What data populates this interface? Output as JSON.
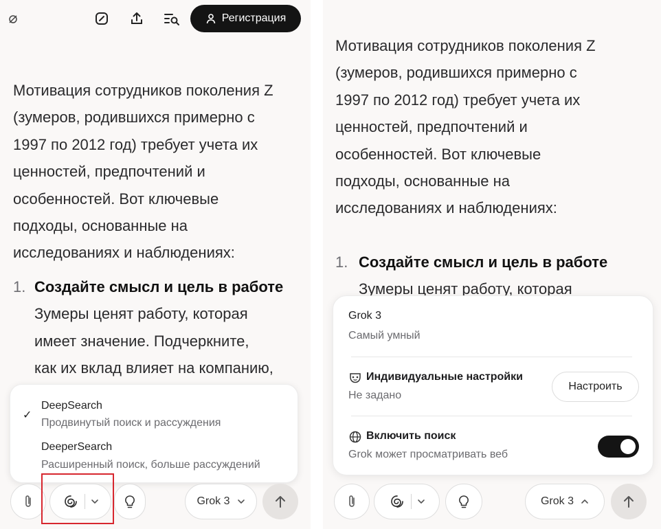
{
  "topbar": {
    "left_icon": "private-chat-icon",
    "edit_icon": "edit-icon",
    "share_icon": "share-icon",
    "history_icon": "history-search-icon",
    "register_label": "Регистрация",
    "register_icon": "user-icon"
  },
  "content": {
    "left_para": [
      "Мотивация сотрудников поколения Z",
      "(зумеров, родившихся примерно с",
      "1997 по 2012 год) требует учета их",
      "ценностей, предпочтений и",
      "особенностей. Вот ключевые",
      "подходы, основанные на",
      "исследованиях и наблюдениях:"
    ],
    "right_para": [
      "Мотивация сотрудников поколения Z",
      "(зумеров, родившихся примерно с",
      "1997 по 2012 год) требует учета их",
      "ценностей, предпочтений и",
      "особенностей. Вот ключевые",
      "подходы, основанные на",
      "исследованиях и наблюдениях:"
    ],
    "list_number": "1.",
    "list_heading": "Создайте смысл и цель в работе",
    "left_list_body": [
      "Зумеры ценят работу, которая",
      "имеет значение. Подчеркните,",
      "как их вклад влияет на компанию,"
    ],
    "right_list_body_partial": "Зумеры ценят работу, которая"
  },
  "dropdown": {
    "options": [
      {
        "title": "DeepSearch",
        "subtitle": "Продвинутый поиск и рассуждения",
        "selected": true,
        "check": "✓"
      },
      {
        "title": "DeeperSearch",
        "subtitle": "Расширенный поиск, больше рассуждений",
        "selected": false,
        "check": ""
      }
    ]
  },
  "composer": {
    "attach_icon": "paperclip-icon",
    "search_mode_icon": "deepsearch-icon",
    "chevron_icon": "chevron-down-icon",
    "think_icon": "lightbulb-icon",
    "model_label": "Grok 3",
    "model_chevron_left": "chevron-down-icon",
    "model_chevron_right": "chevron-up-icon",
    "send_icon": "arrow-up-icon"
  },
  "model_card": {
    "model_name": "Grok 3",
    "model_desc": "Самый умный",
    "custom_title": "Индивидуальные настройки",
    "custom_icon": "mask-icon",
    "custom_status": "Не задано",
    "configure_label": "Настроить",
    "search_title": "Включить поиск",
    "search_icon": "globe-icon",
    "search_desc": "Grok может просматривать веб",
    "search_enabled": true
  },
  "colors": {
    "highlight_box": "#d7262e",
    "dark_button": "#141414",
    "panel_bg": "#faf8f7"
  }
}
